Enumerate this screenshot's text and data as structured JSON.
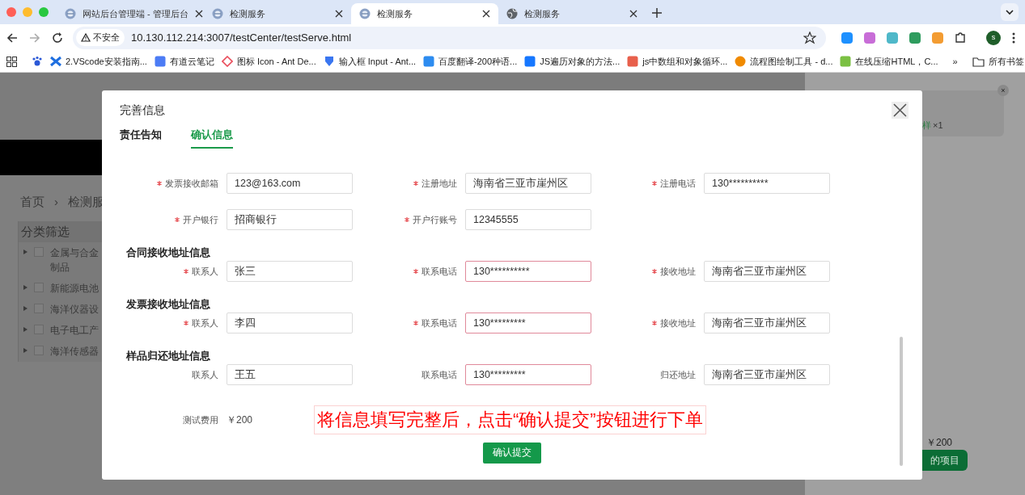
{
  "browser": {
    "tabs": [
      {
        "title": "网站后台管理端 - 管理后台",
        "selected": false,
        "kind": "site"
      },
      {
        "title": "检测服务",
        "selected": false,
        "kind": "site"
      },
      {
        "title": "检测服务",
        "selected": true,
        "kind": "site"
      },
      {
        "title": "检测服务",
        "selected": false,
        "kind": "globe"
      }
    ],
    "security_label": "不安全",
    "url": "10.130.112.214:3007/testCenter/testServe.html",
    "profile_initial": "s",
    "extensions": [
      {
        "color": "#1e90ff"
      },
      {
        "color": "#c86dd7"
      },
      {
        "color": "#4fb8c9"
      },
      {
        "color": "#2e9c5e"
      },
      {
        "color": "#f39c32"
      }
    ],
    "bookmarks": [
      {
        "color": "#2b58d6",
        "kind": "paw"
      },
      {
        "label": "2.VScode安装指南...",
        "color": "#1f6fe0",
        "kind": "mark"
      },
      {
        "label": "有道云笔记",
        "color": "#4c7cf5",
        "kind": "square"
      },
      {
        "label": "图标 Icon - Ant De...",
        "color": "#e94c5a",
        "kind": "diamond"
      },
      {
        "label": "输入框 Input - Ant...",
        "color": "#3a76f0",
        "kind": "shield"
      },
      {
        "label": "百度翻译-200种语...",
        "color": "#2d8cf0",
        "kind": "square"
      },
      {
        "label": "JS遍历对象的方法...",
        "color": "#1677ff",
        "kind": "square"
      },
      {
        "label": "js中数组和对象循环...",
        "color": "#e8604c",
        "kind": "square"
      },
      {
        "label": "流程图绘制工具 - d...",
        "color": "#f08a00",
        "kind": "circle"
      },
      {
        "label": "在线压缩HTML，C...",
        "color": "#7bc043",
        "kind": "square"
      }
    ],
    "bookmarks_overflow": "»",
    "all_bookmarks": "所有书签"
  },
  "background_page": {
    "breadcrumb": [
      "首页",
      "检测服"
    ],
    "breadcrumb_separator": "›",
    "filter_title": "分类筛选",
    "categories": [
      {
        "lines": [
          "金属与合金",
          "制品"
        ],
        "checked": false
      },
      {
        "lines": [
          "新能源电池"
        ],
        "checked": false
      },
      {
        "lines": [
          "海洋仪器设"
        ],
        "checked": false
      },
      {
        "lines": [
          "电子电工产"
        ],
        "checked": false
      },
      {
        "lines": [
          "海洋传感器"
        ],
        "checked": false
      }
    ],
    "cart": {
      "close": "×",
      "item_name": "样",
      "item_qty": "×1",
      "total": "￥200",
      "button": "的项目"
    }
  },
  "modal": {
    "title": "完善信息",
    "tabs": [
      {
        "label": "责任告知",
        "selected": false
      },
      {
        "label": "确认信息",
        "selected": true
      }
    ],
    "rows": [
      {
        "kind": "fields",
        "fields": [
          {
            "label": "发票接收邮箱",
            "required": true,
            "value": "123@163.com",
            "invalid": false
          },
          {
            "label": "注册地址",
            "required": true,
            "value": "海南省三亚市崖州区",
            "invalid": false
          },
          {
            "label": "注册电话",
            "required": true,
            "value": "130**********",
            "invalid": false
          }
        ]
      },
      {
        "kind": "fields",
        "fields": [
          {
            "label": "开户银行",
            "required": true,
            "value": "招商银行",
            "invalid": false
          },
          {
            "label": "开户行账号",
            "required": true,
            "value": "12345555",
            "invalid": false
          }
        ]
      },
      {
        "kind": "section",
        "title": "合同接收地址信息"
      },
      {
        "kind": "fields",
        "fields": [
          {
            "label": "联系人",
            "required": true,
            "value": "张三",
            "invalid": false
          },
          {
            "label": "联系电话",
            "required": true,
            "value": "130**********",
            "invalid": true
          },
          {
            "label": "接收地址",
            "required": true,
            "value": "海南省三亚市崖州区",
            "invalid": false
          }
        ]
      },
      {
        "kind": "section",
        "title": "发票接收地址信息"
      },
      {
        "kind": "fields",
        "fields": [
          {
            "label": "联系人",
            "required": true,
            "value": "李四",
            "invalid": false
          },
          {
            "label": "联系电话",
            "required": true,
            "value": "130*********",
            "invalid": true
          },
          {
            "label": "接收地址",
            "required": true,
            "value": "海南省三亚市崖州区",
            "invalid": false
          }
        ]
      },
      {
        "kind": "section",
        "title": "样品归还地址信息"
      },
      {
        "kind": "fields",
        "fields": [
          {
            "label": "联系人",
            "required": false,
            "value": "王五",
            "invalid": false
          },
          {
            "label": "联系电话",
            "required": false,
            "value": "130*********",
            "invalid": true
          },
          {
            "label": "归还地址",
            "required": false,
            "value": "海南省三亚市崖州区",
            "invalid": false
          }
        ]
      }
    ],
    "fee": {
      "label": "测试费用",
      "value": "￥200"
    },
    "annotation": "将信息填写完整后，点击“确认提交”按钮进行下单",
    "submit": "确认提交"
  }
}
